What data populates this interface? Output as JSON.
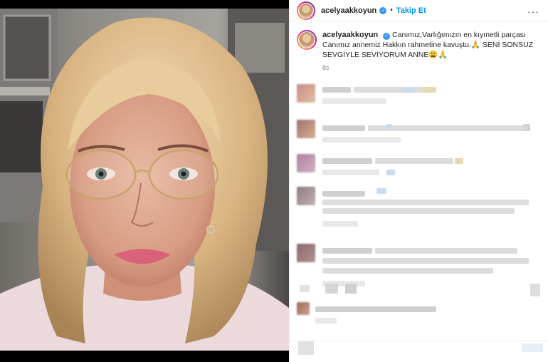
{
  "post": {
    "username": "acelyaakkoyun",
    "follow_label": "Takip Et",
    "separator": "•",
    "more_label": "···",
    "caption": "Canımız,Varlığımızın en kıymetli parçası Canımız annemiz Hakkın rahmetine kavuştu.🙏 SENİ SONSUZ SEVGİYLE SEVİYORUM ANNE😩🙏",
    "time": "8s"
  },
  "icons": {
    "verified": "verified-badge-icon",
    "more": "more-options-icon"
  },
  "colors": {
    "accent_blue": "#0095f6",
    "verified_blue": "#3897f0",
    "muted_text": "#8e8e8e"
  }
}
